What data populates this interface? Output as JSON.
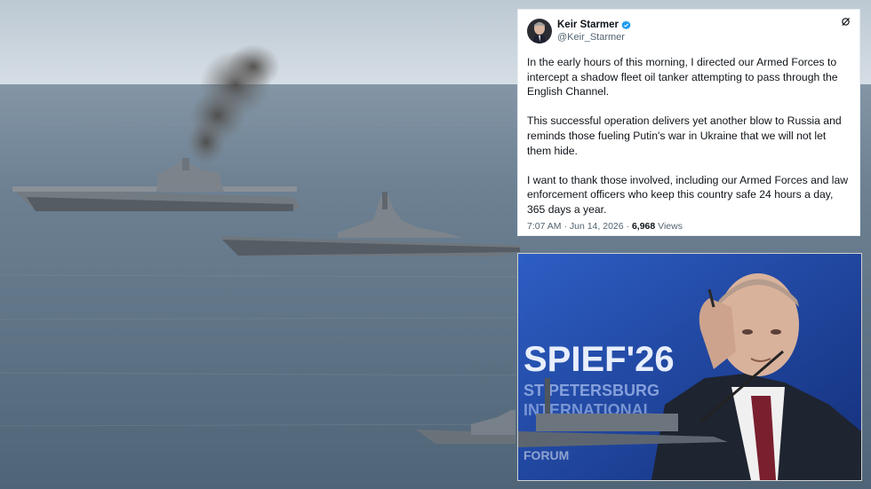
{
  "tweet": {
    "display_name": "Keir Starmer",
    "handle": "@Keir_Starmer",
    "paragraphs": [
      "In the early hours of this morning, I directed our Armed Forces to intercept a shadow fleet oil tanker attempting to pass through the English Channel.",
      "This successful operation delivers yet another blow to Russia and reminds those fueling Putin's war in Ukraine that we will not let them hide.",
      "I want to thank those involved, including our Armed Forces and law enforcement officers who keep this country safe 24 hours a day, 365 days a year."
    ],
    "time": "7:07 AM",
    "separator": "·",
    "date": "Jun 14, 2026",
    "views_count": "6,968",
    "views_label": "Views"
  },
  "inset_photo": {
    "banner_text": "SPIEF'26",
    "banner_sub1": "ST PETERSBURG",
    "banner_sub2": "INTERNATIONAL",
    "banner_sub3": "FORUM"
  },
  "colors": {
    "sea": "#5d7183",
    "sky": "#c8d3dc",
    "verified": "#1d9bf0",
    "stage_blue": "#1b4aa5"
  },
  "icons": [
    "verified-badge-icon",
    "grok-icon"
  ]
}
